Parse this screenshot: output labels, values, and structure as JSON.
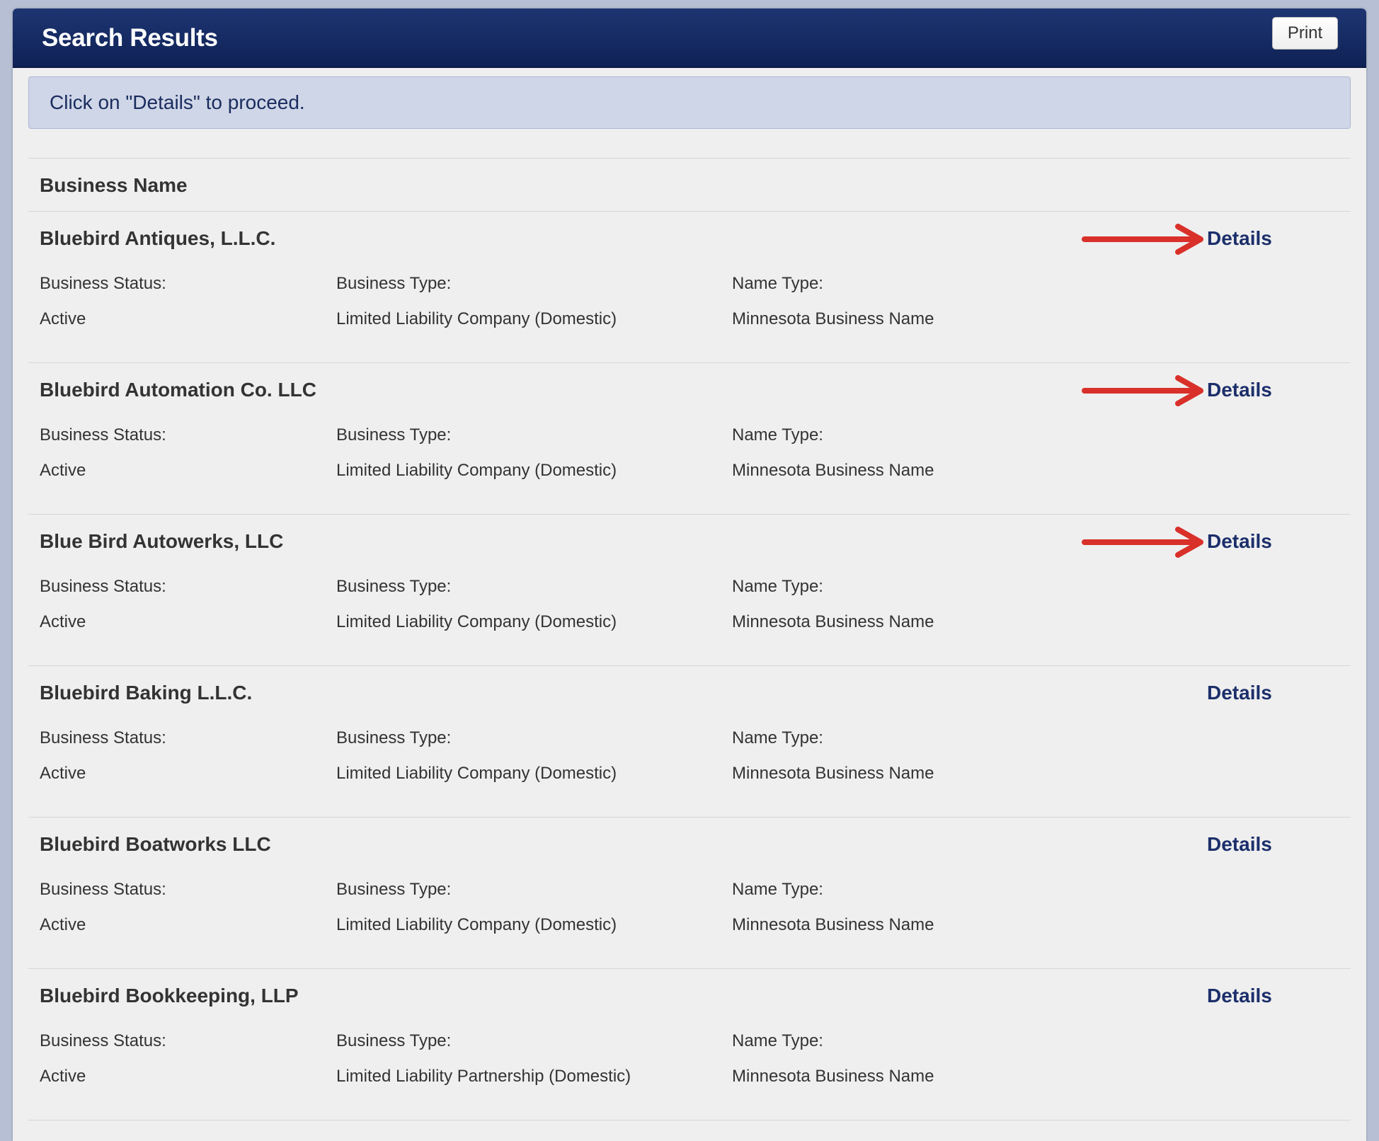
{
  "header": {
    "title": "Search Results",
    "print_label": "Print"
  },
  "banner": {
    "text": "Click on \"Details\" to proceed."
  },
  "table": {
    "column_header": "Business Name",
    "status_label": "Business Status:",
    "type_label": "Business Type:",
    "name_type_label": "Name Type:",
    "details_label": "Details"
  },
  "results": [
    {
      "name": "Bluebird Antiques, L.L.C.",
      "status": "Active",
      "business_type": "Limited Liability Company (Domestic)",
      "name_type": "Minnesota Business Name",
      "highlighted": true
    },
    {
      "name": "Bluebird Automation Co. LLC",
      "status": "Active",
      "business_type": "Limited Liability Company (Domestic)",
      "name_type": "Minnesota Business Name",
      "highlighted": true
    },
    {
      "name": "Blue Bird Autowerks, LLC",
      "status": "Active",
      "business_type": "Limited Liability Company (Domestic)",
      "name_type": "Minnesota Business Name",
      "highlighted": true
    },
    {
      "name": "Bluebird Baking L.L.C.",
      "status": "Active",
      "business_type": "Limited Liability Company (Domestic)",
      "name_type": "Minnesota Business Name",
      "highlighted": false
    },
    {
      "name": "Bluebird Boatworks LLC",
      "status": "Active",
      "business_type": "Limited Liability Company (Domestic)",
      "name_type": "Minnesota Business Name",
      "highlighted": false
    },
    {
      "name": "Bluebird Bookkeeping, LLP",
      "status": "Active",
      "business_type": "Limited Liability Partnership (Domestic)",
      "name_type": "Minnesota Business Name",
      "highlighted": false
    }
  ],
  "colors": {
    "header_bg": "#142a63",
    "banner_bg": "#cfd6e7",
    "link": "#1c2f6b",
    "annotation_arrow": "#d9302a"
  },
  "icons": {
    "annotation": "red-arrow-right-icon"
  }
}
